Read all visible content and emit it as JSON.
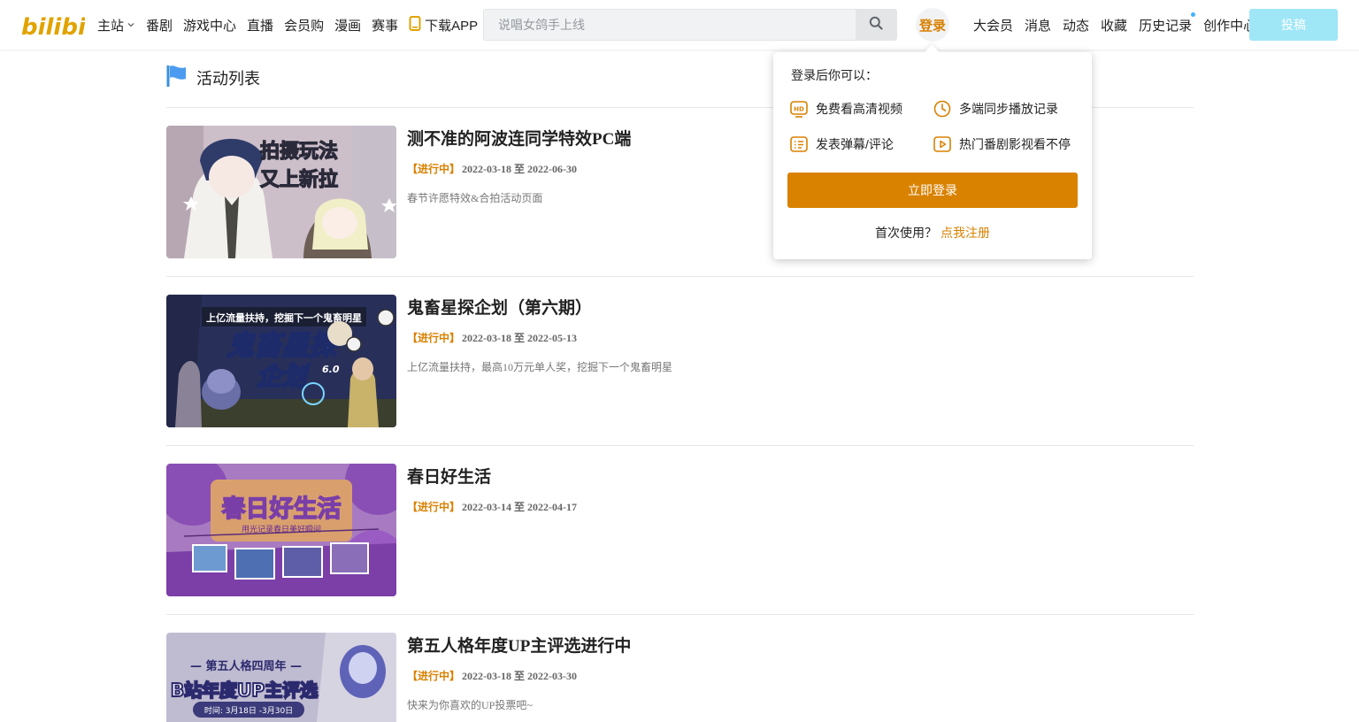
{
  "header": {
    "logo_text": "bilibili",
    "nav": [
      {
        "label": "主站"
      },
      {
        "label": "番剧"
      },
      {
        "label": "游戏中心"
      },
      {
        "label": "直播"
      },
      {
        "label": "会员购"
      },
      {
        "label": "漫画"
      },
      {
        "label": "赛事"
      },
      {
        "label": "下载APP"
      }
    ],
    "search": {
      "placeholder": "说唱女鸽手上线",
      "value": ""
    },
    "login_label": "登录",
    "right_nav": [
      {
        "label": "大会员"
      },
      {
        "label": "消息"
      },
      {
        "label": "动态"
      },
      {
        "label": "收藏"
      },
      {
        "label": "历史记录"
      },
      {
        "label": "创作中心"
      }
    ],
    "upload_label": "投稿"
  },
  "section": {
    "title": "活动列表"
  },
  "activities": [
    {
      "title": "测不准的阿波连同学特效PC端",
      "status": "【进行中】",
      "dates": "2022-03-18 至 2022-06-30",
      "desc": "春节许愿特效&合拍活动页面",
      "thumb_text": [
        "拍摄玩法",
        "又上新拉"
      ]
    },
    {
      "title": "鬼畜星探企划（第六期）",
      "status": "【进行中】",
      "dates": "2022-03-18 至 2022-05-13",
      "desc": "上亿流量扶持，最高10万元单人奖，挖掘下一个鬼畜明星",
      "thumb_text": [
        "上亿流量扶持，挖掘下一个鬼畜明星",
        "鬼畜星探",
        "企划",
        "6.0"
      ]
    },
    {
      "title": "春日好生活",
      "status": "【进行中】",
      "dates": "2022-03-14 至 2022-04-17",
      "desc": "",
      "thumb_text": [
        "春日好生活",
        "用光记录春日美好瞬间"
      ]
    },
    {
      "title": "第五人格年度UP主评选进行中",
      "status": "【进行中】",
      "dates": "2022-03-18 至 2022-03-30",
      "desc": "快来为你喜欢的UP投票吧~",
      "thumb_text": [
        "— 第五人格四周年 —",
        "B站年度UP主评选",
        "时间: 3月18日 -3月30日"
      ]
    }
  ],
  "login_popup": {
    "heading": "登录后你可以：",
    "features": [
      {
        "label": "免费看高清视频",
        "icon": "hd-icon"
      },
      {
        "label": "多端同步播放记录",
        "icon": "clock-icon"
      },
      {
        "label": "发表弹幕/评论",
        "icon": "comment-list-icon"
      },
      {
        "label": "热门番剧影视看不停",
        "icon": "play-icon"
      }
    ],
    "login_button": "立即登录",
    "first_use": "首次使用？",
    "register_link": "点我注册"
  },
  "colors": {
    "accent": "#d98000",
    "upload": "#9fe6f7",
    "logo": "#e1a300"
  }
}
